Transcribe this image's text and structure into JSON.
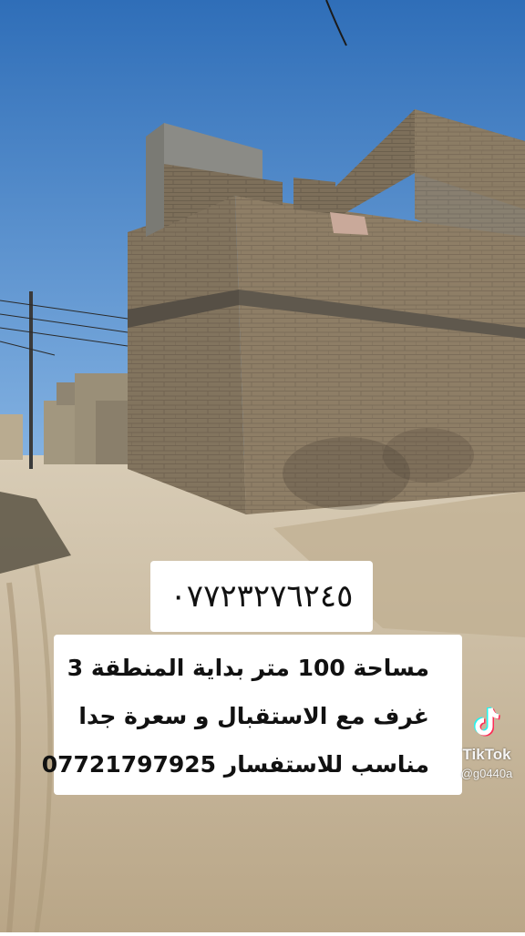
{
  "overlay": {
    "phone_caption": "٠٧٧٢٣٢٧٦٢٤٥",
    "lines": [
      "مساحة 100 متر  بداية المنطقة 3",
      "غرف مع الاستقبال و سعرة جدا",
      "مناسب للاستفسار 07721797925"
    ]
  },
  "watermark": {
    "label": "TikTok",
    "handle": "@g0440a",
    "icon": "tiktok-logo-icon"
  },
  "colors": {
    "sky": "#3f7fc6",
    "brick": "#8f7f66",
    "ground": "#c9b79b"
  }
}
